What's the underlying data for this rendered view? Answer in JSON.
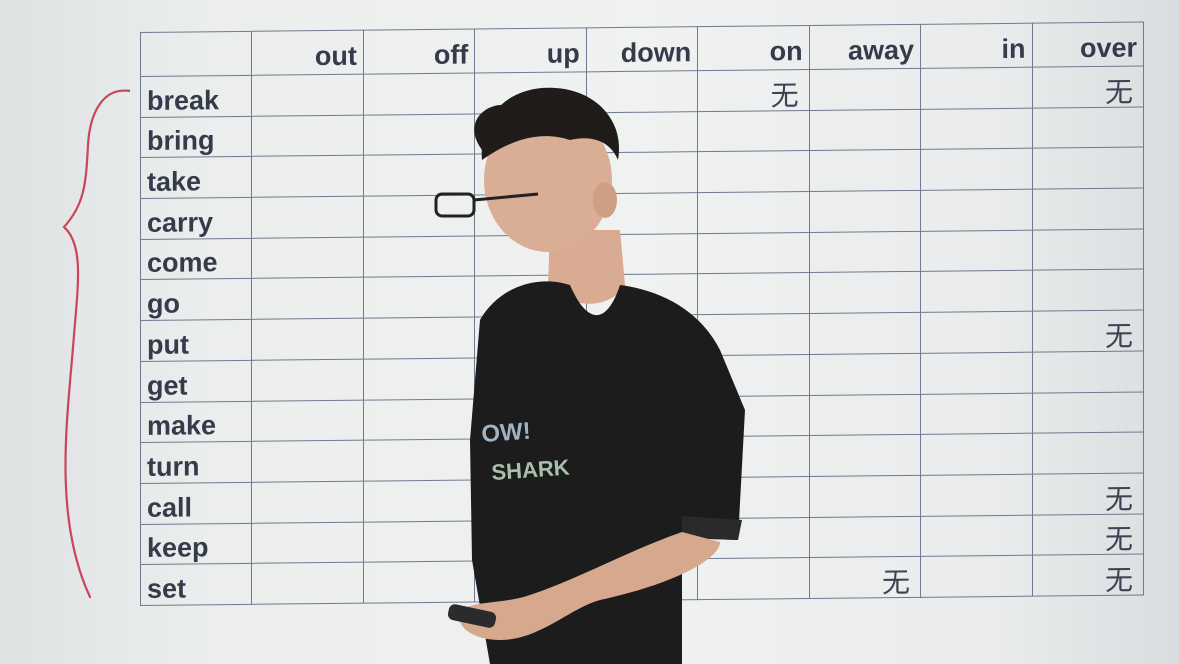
{
  "table": {
    "columns": [
      "",
      "out",
      "off",
      "up",
      "down",
      "on",
      "away",
      "in",
      "over"
    ],
    "rows": [
      {
        "verb": "break",
        "cells": [
          "",
          "",
          "",
          "",
          "无",
          "",
          "",
          "无"
        ]
      },
      {
        "verb": "bring",
        "cells": [
          "",
          "",
          "",
          "",
          "",
          "",
          "",
          ""
        ]
      },
      {
        "verb": "take",
        "cells": [
          "",
          "",
          "",
          "",
          "",
          "",
          "",
          ""
        ]
      },
      {
        "verb": "carry",
        "cells": [
          "",
          "",
          "",
          "",
          "",
          "",
          "",
          ""
        ]
      },
      {
        "verb": "come",
        "cells": [
          "",
          "",
          "",
          "",
          "",
          "",
          "",
          ""
        ]
      },
      {
        "verb": "go",
        "cells": [
          "",
          "",
          "",
          "",
          "",
          "",
          "",
          ""
        ]
      },
      {
        "verb": "put",
        "cells": [
          "",
          "",
          "",
          "",
          "",
          "",
          "",
          "无"
        ]
      },
      {
        "verb": "get",
        "cells": [
          "",
          "",
          "",
          "",
          "",
          "",
          "",
          ""
        ]
      },
      {
        "verb": "make",
        "cells": [
          "",
          "",
          "",
          "",
          "",
          "",
          "",
          ""
        ]
      },
      {
        "verb": "turn",
        "cells": [
          "",
          "",
          "",
          "",
          "",
          "",
          "",
          ""
        ]
      },
      {
        "verb": "call",
        "cells": [
          "",
          "",
          "",
          "",
          "",
          "",
          "",
          "无"
        ]
      },
      {
        "verb": "keep",
        "cells": [
          "",
          "",
          "",
          "",
          "",
          "",
          "",
          "无"
        ]
      },
      {
        "verb": "set",
        "cells": [
          "",
          "",
          "",
          "",
          "",
          "无",
          "",
          "无"
        ]
      }
    ]
  },
  "shirt": {
    "line1": "OW!",
    "line2": "SHARK"
  },
  "colors": {
    "grid": "#6f7a8e",
    "text": "#343c4c",
    "brace": "#c9465a",
    "shirt": "#1c1c1c"
  }
}
